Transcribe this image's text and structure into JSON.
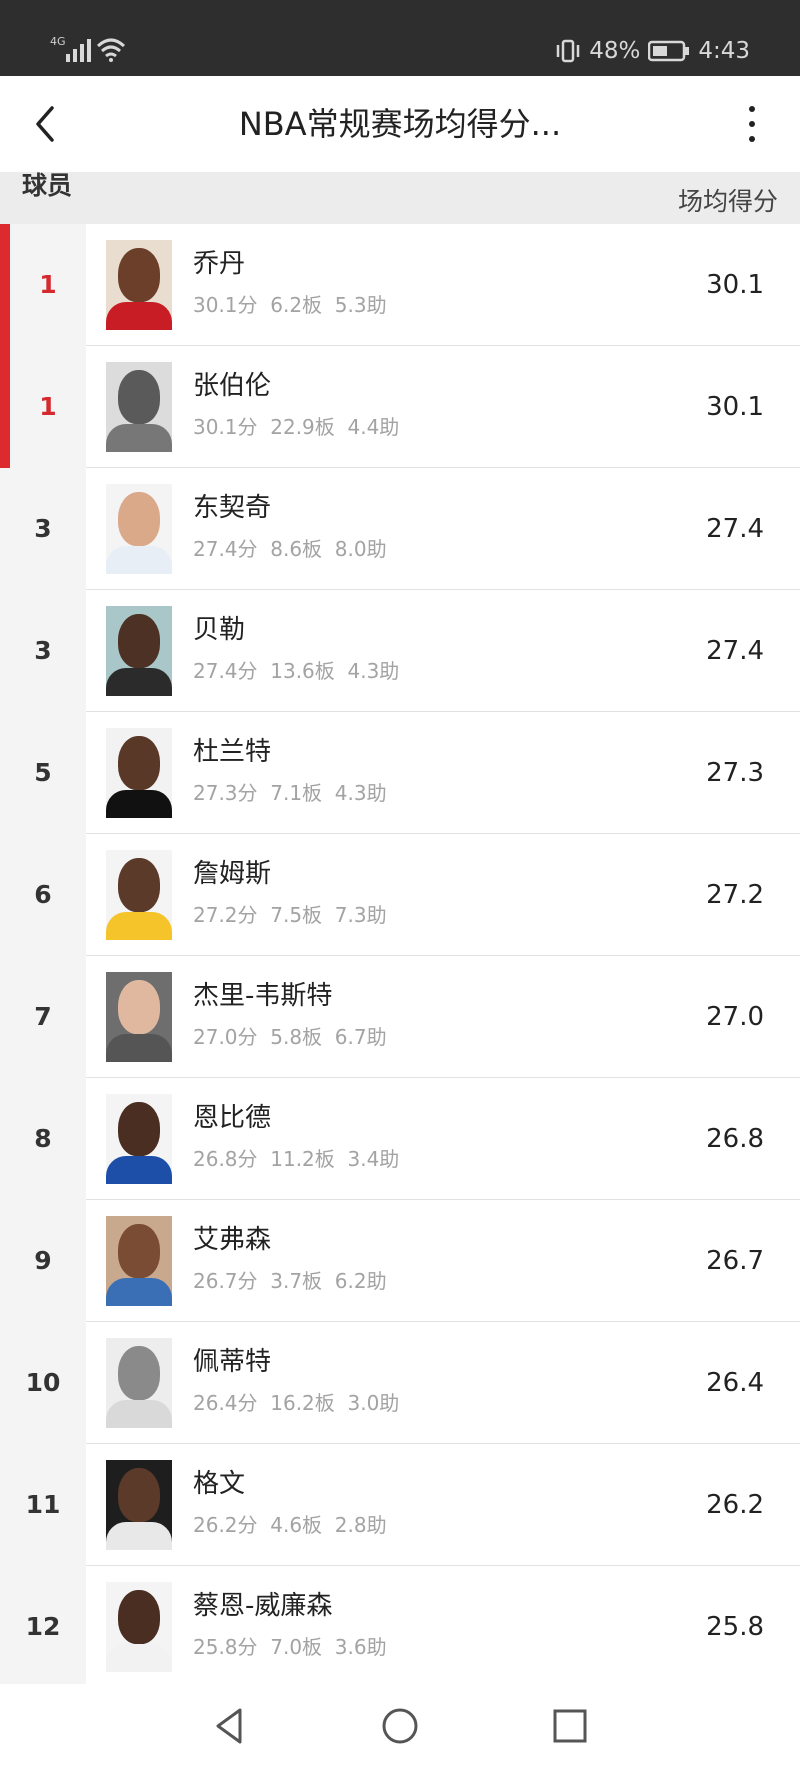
{
  "status_bar": {
    "network": "4G",
    "battery_percent": "48%",
    "time": "4:43"
  },
  "header": {
    "title": "NBA常规赛场均得分..."
  },
  "columns": {
    "player": "球员",
    "ppg": "场均得分"
  },
  "players": [
    {
      "rank": "1",
      "name": "乔丹",
      "stats": "30.1分  6.2板  5.3助",
      "ppg": "30.1",
      "top": true,
      "skin": "#6b3f2a",
      "jersey": "#c81d25",
      "bg": "#e9ddd0"
    },
    {
      "rank": "1",
      "name": "张伯伦",
      "stats": "30.1分  22.9板  4.4助",
      "ppg": "30.1",
      "top": true,
      "skin": "#5a5a5a",
      "jersey": "#777777",
      "bg": "#dcdcdc"
    },
    {
      "rank": "3",
      "name": "东契奇",
      "stats": "27.4分  8.6板  8.0助",
      "ppg": "27.4",
      "top": false,
      "skin": "#d9a98a",
      "jersey": "#e8eef5",
      "bg": "#f4f4f4"
    },
    {
      "rank": "3",
      "name": "贝勒",
      "stats": "27.4分  13.6板  4.3助",
      "ppg": "27.4",
      "top": false,
      "skin": "#4d3125",
      "jersey": "#2b2b2b",
      "bg": "#a9c6c9"
    },
    {
      "rank": "5",
      "name": "杜兰特",
      "stats": "27.3分  7.1板  4.3助",
      "ppg": "27.3",
      "top": false,
      "skin": "#5a3828",
      "jersey": "#111111",
      "bg": "#f2f2f2"
    },
    {
      "rank": "6",
      "name": "詹姆斯",
      "stats": "27.2分  7.5板  7.3助",
      "ppg": "27.2",
      "top": false,
      "skin": "#5b3a2a",
      "jersey": "#f5c42a",
      "bg": "#f4f4f4"
    },
    {
      "rank": "7",
      "name": "杰里-韦斯特",
      "stats": "27.0分  5.8板  6.7助",
      "ppg": "27.0",
      "top": false,
      "skin": "#e0b8a0",
      "jersey": "#555555",
      "bg": "#6e6e6e"
    },
    {
      "rank": "8",
      "name": "恩比德",
      "stats": "26.8分  11.2板  3.4助",
      "ppg": "26.8",
      "top": false,
      "skin": "#4a2e22",
      "jersey": "#1d4fa8",
      "bg": "#f4f4f4"
    },
    {
      "rank": "9",
      "name": "艾弗森",
      "stats": "26.7分  3.7板  6.2助",
      "ppg": "26.7",
      "top": false,
      "skin": "#7a4c33",
      "jersey": "#3a6fb5",
      "bg": "#c9a98e"
    },
    {
      "rank": "10",
      "name": "佩蒂特",
      "stats": "26.4分  16.2板  3.0助",
      "ppg": "26.4",
      "top": false,
      "skin": "#8a8a8a",
      "jersey": "#d9d9d9",
      "bg": "#ededed"
    },
    {
      "rank": "11",
      "name": "格文",
      "stats": "26.2分  4.6板  2.8助",
      "ppg": "26.2",
      "top": false,
      "skin": "#5b3a2a",
      "jersey": "#e8e8e8",
      "bg": "#1e1e1e"
    },
    {
      "rank": "12",
      "name": "蔡恩-威廉森",
      "stats": "25.8分  7.0板  3.6助",
      "ppg": "25.8",
      "top": false,
      "skin": "#4a2e22",
      "jersey": "#f2f2f2",
      "bg": "#f4f4f4"
    }
  ],
  "navigation": {
    "back": "back-triangle",
    "home": "home-circle",
    "recents": "recents-square"
  }
}
